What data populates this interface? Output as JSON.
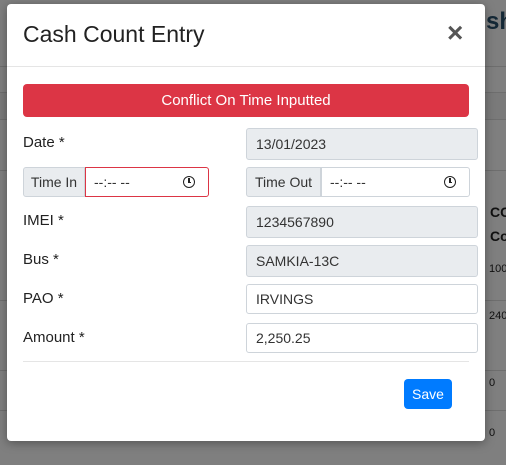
{
  "background": {
    "heading_fragment": "sh",
    "col_header_1": "CC",
    "col_header_2": "Co",
    "cells": [
      "100",
      "240",
      "0",
      "0"
    ]
  },
  "modal": {
    "title": "Cash Count Entry",
    "close_glyph": "×",
    "alert": "Conflict On Time Inputted",
    "date": {
      "label": "Date *",
      "value": "13/01/2023"
    },
    "time_in": {
      "label": "Time In",
      "placeholder": "--:-- --"
    },
    "time_out": {
      "label": "Time Out",
      "placeholder": "--:-- --"
    },
    "imei": {
      "label": "IMEI *",
      "value": "1234567890"
    },
    "bus": {
      "label": "Bus *",
      "value": "SAMKIA-13C"
    },
    "pao": {
      "label": "PAO *",
      "value": "IRVINGS"
    },
    "amount": {
      "label": "Amount *",
      "value": "2,250.25"
    },
    "save_label": "Save"
  },
  "colors": {
    "danger": "#dc3545",
    "primary": "#007bff",
    "invalid_border": "#dc3545"
  },
  "icons": [
    "close-icon",
    "clock-icon"
  ]
}
